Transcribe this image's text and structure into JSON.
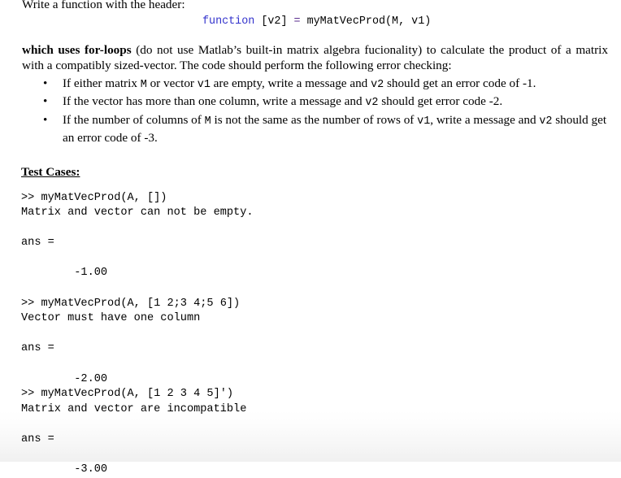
{
  "document": {
    "intro_line": "Write a function with the header:",
    "code_header": {
      "keyword": "function",
      "output_args": " [v2] ",
      "equals": "=",
      "signature": " myMatVecProd(M, v1)"
    },
    "keyword_color": "#3333CC",
    "equals_color": "#5B2D8E",
    "body_paragraph": {
      "bold_lead": "which uses for-loops",
      "rest": " (do not use Matlab’s built-in matrix algebra fucionality) to calculate the product of a matrix with a compatibly sized-vector.  The code should perform the following error checking:"
    },
    "bullets": [
      {
        "bullet_glyph": "•",
        "segments": [
          {
            "text": "If either matrix ",
            "mono": false
          },
          {
            "text": "M",
            "mono": true
          },
          {
            "text": " or vector ",
            "mono": false
          },
          {
            "text": "v1",
            "mono": true
          },
          {
            "text": " are empty, write a message and  ",
            "mono": false
          },
          {
            "text": "v2",
            "mono": true
          },
          {
            "text": " should get an error code of -1.",
            "mono": false
          }
        ]
      },
      {
        "bullet_glyph": "•",
        "segments": [
          {
            "text": "If the vector has more than one column, write a message and ",
            "mono": false
          },
          {
            "text": "v2",
            "mono": true
          },
          {
            "text": " should get error code -2.",
            "mono": false
          }
        ]
      },
      {
        "bullet_glyph": "•",
        "segments": [
          {
            "text": "If the number of columns of  ",
            "mono": false
          },
          {
            "text": "M",
            "mono": true
          },
          {
            "text": " is not the same as the number of rows of ",
            "mono": false
          },
          {
            "text": "v1",
            "mono": true
          },
          {
            "text": ", write a message and ",
            "mono": false
          },
          {
            "text": "v2",
            "mono": true
          },
          {
            "text": " should get an error code of -3.",
            "mono": false
          }
        ]
      }
    ],
    "test_cases_heading": "Test Cases:",
    "console_output": ">> myMatVecProd(A, [])\nMatrix and vector can not be empty.\n\nans =\n\n        -1.00\n\n>> myMatVecProd(A, [1 2;3 4;5 6])\nVector must have one column\n\nans =\n\n        -2.00\n>> myMatVecProd(A, [1 2 3 4 5]')\nMatrix and vector are incompatible\n\nans =\n\n        -3.00"
  }
}
